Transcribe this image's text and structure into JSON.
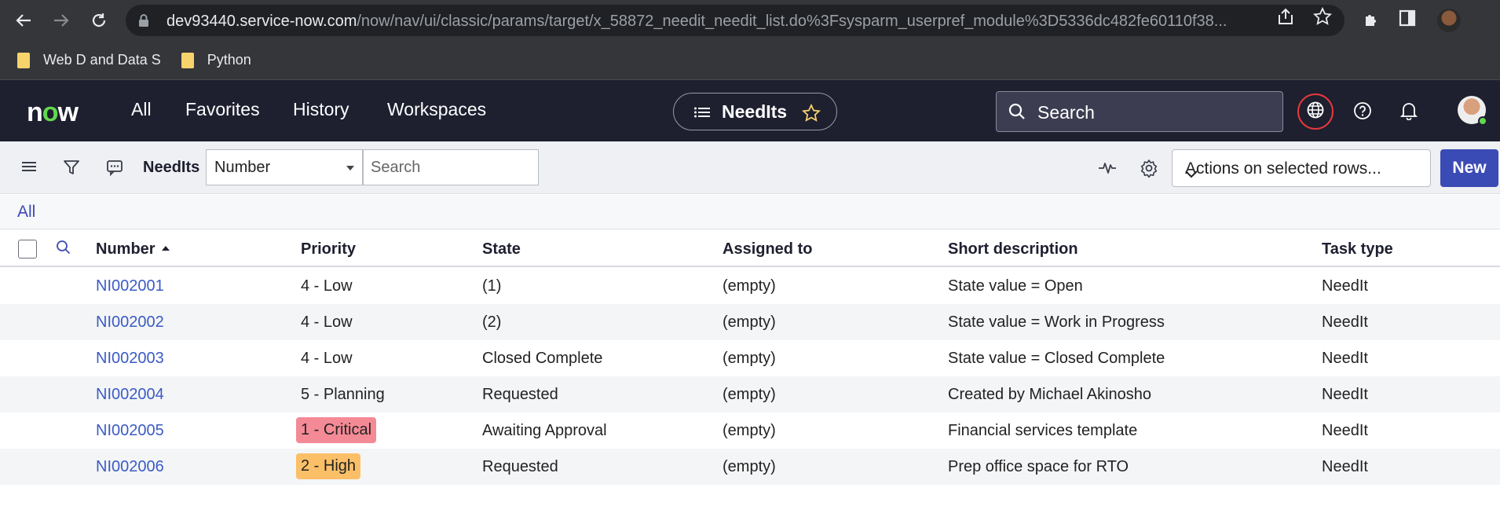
{
  "browser": {
    "url_host": "dev93440.service-now.com",
    "url_path": "/now/nav/ui/classic/params/target/x_58872_needit_needit_list.do%3Fsysparm_userpref_module%3D5336dc482fe60110f38...",
    "bookmarks": [
      "Web D and Data S",
      "Python"
    ]
  },
  "header": {
    "logo": "now",
    "nav": [
      "All",
      "Favorites",
      "History",
      "Workspaces"
    ],
    "context_title": "NeedIts",
    "search_placeholder": "Search"
  },
  "toolbar": {
    "list_title": "NeedIts",
    "field_select": "Number",
    "search_placeholder": "Search",
    "actions_label": "Actions on selected rows...",
    "new_label": "New"
  },
  "breadcrumb": "All",
  "table": {
    "columns": [
      "Number",
      "Priority",
      "State",
      "Assigned to",
      "Short description",
      "Task type"
    ],
    "rows": [
      {
        "number": "NI002001",
        "priority": "4 - Low",
        "state": "(1)",
        "assigned": "(empty)",
        "desc": "State value = Open",
        "type": "NeedIt"
      },
      {
        "number": "NI002002",
        "priority": "4 - Low",
        "state": "(2)",
        "assigned": "(empty)",
        "desc": "State value = Work in Progress",
        "type": "NeedIt"
      },
      {
        "number": "NI002003",
        "priority": "4 - Low",
        "state": "Closed Complete",
        "assigned": "(empty)",
        "desc": "State value = Closed Complete",
        "type": "NeedIt"
      },
      {
        "number": "NI002004",
        "priority": "5 - Planning",
        "state": "Requested",
        "assigned": "(empty)",
        "desc": "Created by Michael Akinosho",
        "type": "NeedIt"
      },
      {
        "number": "NI002005",
        "priority": "1 - Critical",
        "state": "Awaiting Approval",
        "assigned": "(empty)",
        "desc": "Financial services template",
        "type": "NeedIt"
      },
      {
        "number": "NI002006",
        "priority": "2 - High",
        "state": "Requested",
        "assigned": "(empty)",
        "desc": "Prep office space for RTO",
        "type": "NeedIt"
      }
    ]
  },
  "colors": {
    "critical_badge": "#f48a96",
    "high_badge": "#fbbf67",
    "link": "#3b5bc4",
    "header_bg": "#1e1f2f",
    "new_button": "#3b4bb5"
  }
}
